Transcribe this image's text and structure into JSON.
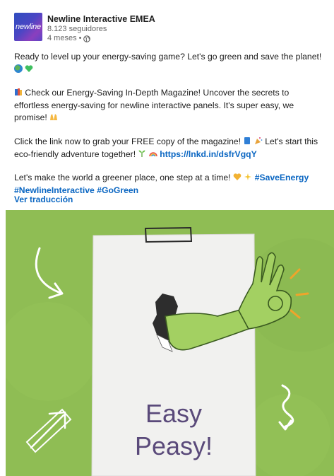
{
  "post": {
    "company": "Newline Interactive EMEA",
    "logo_text": "newline",
    "followers": "8.123 seguidores",
    "time": "4 meses •",
    "globe_icon": "globe-icon",
    "p1": "Ready to level up your energy-saving game? Let's go green and save the planet!",
    "p2": "Check our Energy-Saving In-Depth Magazine! Uncover the secrets to effortless energy-saving for newline interactive panels. It's super easy, we promise!",
    "p3a": "Click the link now to grab your FREE copy of the magazine!",
    "p3b": "Let's start this eco-friendly adventure together!",
    "link": "https://lnkd.in/dsfrVgqY",
    "p4": "Let's make the world a greener place, one step at a time!",
    "tag1": "#SaveEnergy",
    "tag2": "#NewlineInteractive",
    "tag3": "#GoGreen",
    "translate": "Ver traducción"
  },
  "image": {
    "line1": "Easy",
    "line2": "Peasy!",
    "bg_color": "#8fbd54",
    "hand_color": "#a3d062"
  }
}
